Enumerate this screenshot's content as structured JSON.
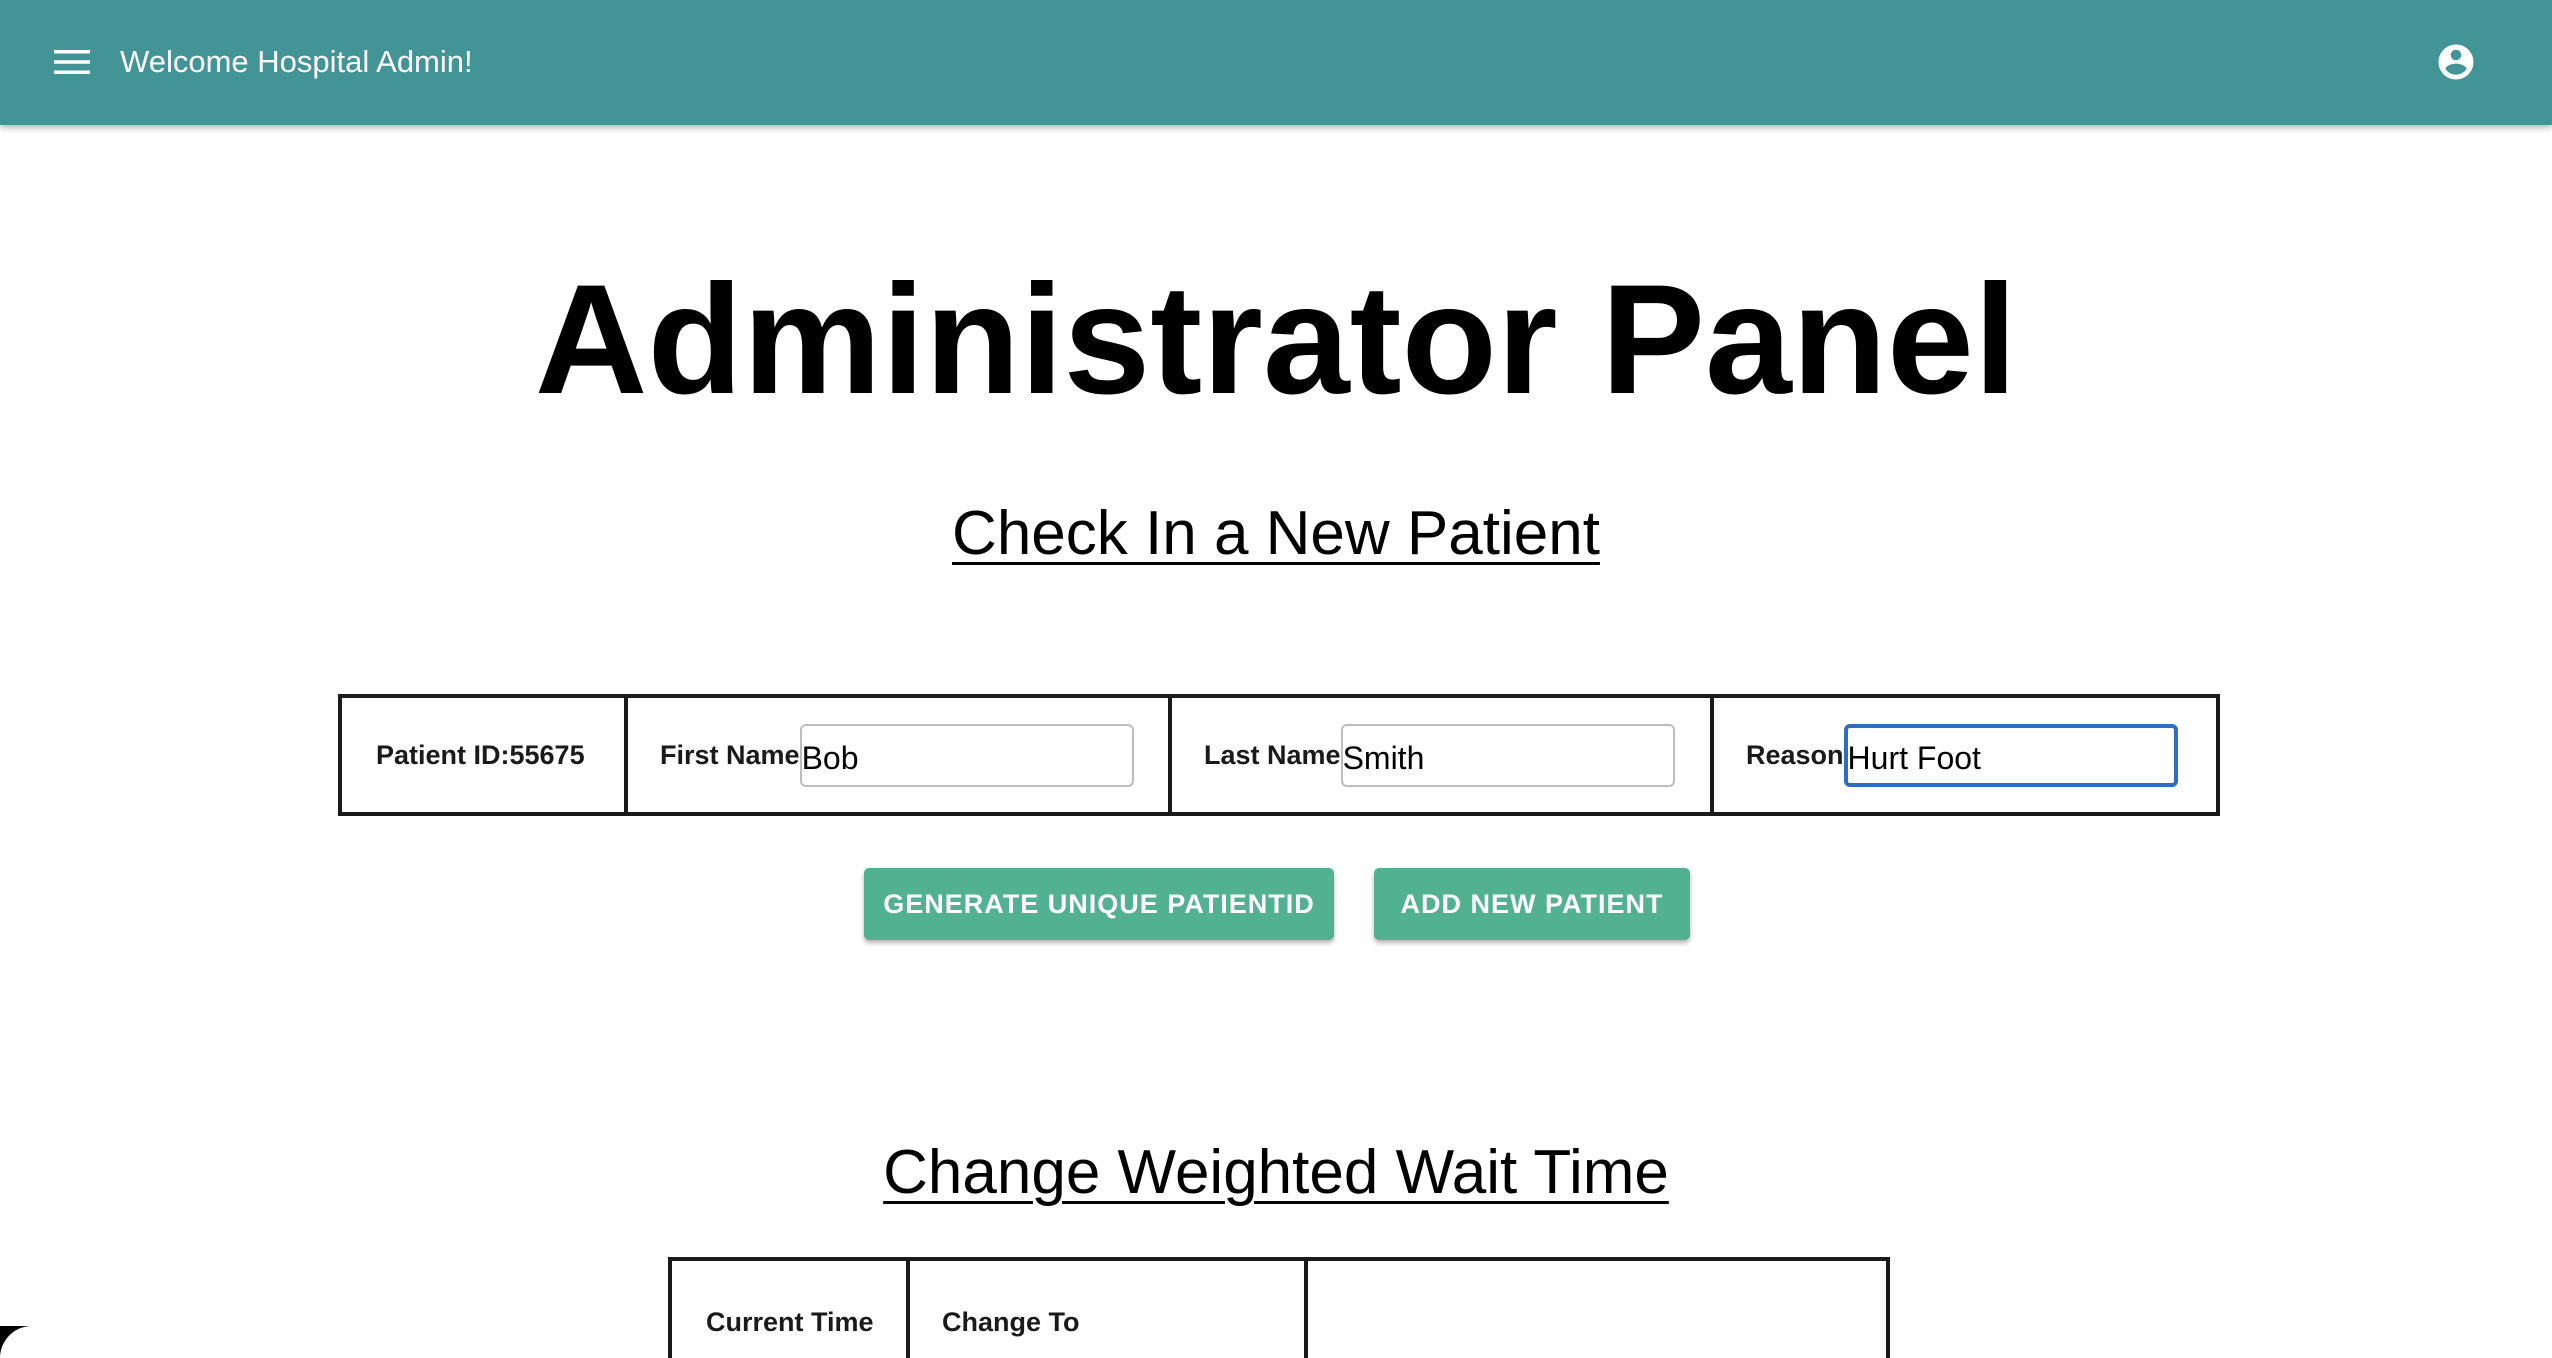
{
  "appbar": {
    "title": "Welcome Hospital Admin!",
    "menu_icon": "menu-icon",
    "account_icon": "account-circle-icon",
    "color": "#429496"
  },
  "page": {
    "title": "Administrator Panel"
  },
  "checkin": {
    "heading": "Check In a New Patient",
    "patient_id_label": "Patient ID:55675",
    "first_name_label": "First Name",
    "first_name_value": "Bob",
    "last_name_label": "Last Name",
    "last_name_value": "Smith",
    "reason_label": "Reason",
    "reason_value": "Hurt Foot",
    "generate_button": "GENERATE UNIQUE PATIENTID",
    "add_button": "ADD NEW PATIENT",
    "button_color": "#51b191"
  },
  "wait_time": {
    "heading": "Change Weighted Wait Time",
    "current_time_label": "Current Time",
    "change_to_label": "Change To"
  }
}
